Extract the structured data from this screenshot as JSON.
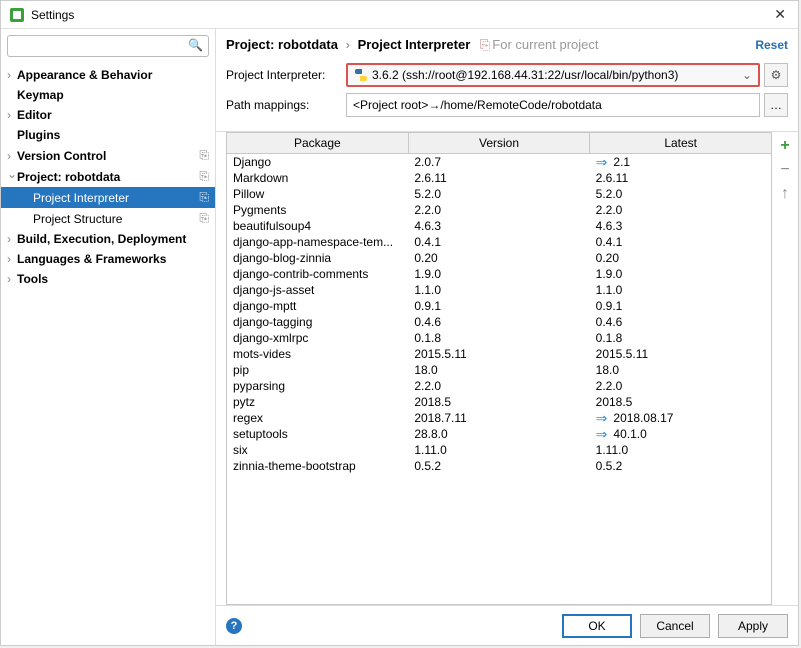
{
  "title": "Settings",
  "search": {
    "placeholder": ""
  },
  "sidebar": {
    "items": [
      {
        "label": "Appearance & Behavior",
        "bold": true,
        "expandable": true
      },
      {
        "label": "Keymap",
        "bold": true
      },
      {
        "label": "Editor",
        "bold": true,
        "expandable": true
      },
      {
        "label": "Plugins",
        "bold": true
      },
      {
        "label": "Version Control",
        "bold": true,
        "expandable": true,
        "endIcon": true
      },
      {
        "label": "Project: robotdata",
        "bold": true,
        "expandable": true,
        "expanded": true,
        "endIcon": true
      },
      {
        "label": "Project Interpreter",
        "depth": 2,
        "selected": true,
        "endIcon": true
      },
      {
        "label": "Project Structure",
        "depth": 2,
        "endIcon": true
      },
      {
        "label": "Build, Execution, Deployment",
        "bold": true,
        "expandable": true
      },
      {
        "label": "Languages & Frameworks",
        "bold": true,
        "expandable": true
      },
      {
        "label": "Tools",
        "bold": true,
        "expandable": true
      }
    ]
  },
  "breadcrumb": {
    "p1": "Project: robotdata",
    "p2": "Project Interpreter",
    "sub": "For current project",
    "reset": "Reset"
  },
  "form": {
    "interpreter_label": "Project Interpreter:",
    "interpreter_value": "3.6.2 (ssh://root@192.168.44.31:22/usr/local/bin/python3)",
    "path_label": "Path mappings:",
    "path_value": "<Project root>→/home/RemoteCode/robotdata"
  },
  "table": {
    "headers": [
      "Package",
      "Version",
      "Latest"
    ],
    "rows": [
      {
        "pkg": "Django",
        "ver": "2.0.7",
        "latest": "2.1",
        "update": true
      },
      {
        "pkg": "Markdown",
        "ver": "2.6.11",
        "latest": "2.6.11"
      },
      {
        "pkg": "Pillow",
        "ver": "5.2.0",
        "latest": "5.2.0"
      },
      {
        "pkg": "Pygments",
        "ver": "2.2.0",
        "latest": "2.2.0"
      },
      {
        "pkg": "beautifulsoup4",
        "ver": "4.6.3",
        "latest": "4.6.3"
      },
      {
        "pkg": "django-app-namespace-tem...",
        "ver": "0.4.1",
        "latest": "0.4.1"
      },
      {
        "pkg": "django-blog-zinnia",
        "ver": "0.20",
        "latest": "0.20"
      },
      {
        "pkg": "django-contrib-comments",
        "ver": "1.9.0",
        "latest": "1.9.0"
      },
      {
        "pkg": "django-js-asset",
        "ver": "1.1.0",
        "latest": "1.1.0"
      },
      {
        "pkg": "django-mptt",
        "ver": "0.9.1",
        "latest": "0.9.1"
      },
      {
        "pkg": "django-tagging",
        "ver": "0.4.6",
        "latest": "0.4.6"
      },
      {
        "pkg": "django-xmlrpc",
        "ver": "0.1.8",
        "latest": "0.1.8"
      },
      {
        "pkg": "mots-vides",
        "ver": "2015.5.11",
        "latest": "2015.5.11"
      },
      {
        "pkg": "pip",
        "ver": "18.0",
        "latest": "18.0"
      },
      {
        "pkg": "pyparsing",
        "ver": "2.2.0",
        "latest": "2.2.0"
      },
      {
        "pkg": "pytz",
        "ver": "2018.5",
        "latest": "2018.5"
      },
      {
        "pkg": "regex",
        "ver": "2018.7.11",
        "latest": "2018.08.17",
        "update": true
      },
      {
        "pkg": "setuptools",
        "ver": "28.8.0",
        "latest": "40.1.0",
        "update": true
      },
      {
        "pkg": "six",
        "ver": "1.11.0",
        "latest": "1.11.0"
      },
      {
        "pkg": "zinnia-theme-bootstrap",
        "ver": "0.5.2",
        "latest": "0.5.2"
      }
    ]
  },
  "footer": {
    "ok": "OK",
    "cancel": "Cancel",
    "apply": "Apply"
  },
  "icons": {
    "search": "🔍",
    "gear": "⚙",
    "dots": "…",
    "update_arrow": "⇒",
    "add": "+",
    "minus": "−",
    "up": "↑",
    "help": "?"
  }
}
